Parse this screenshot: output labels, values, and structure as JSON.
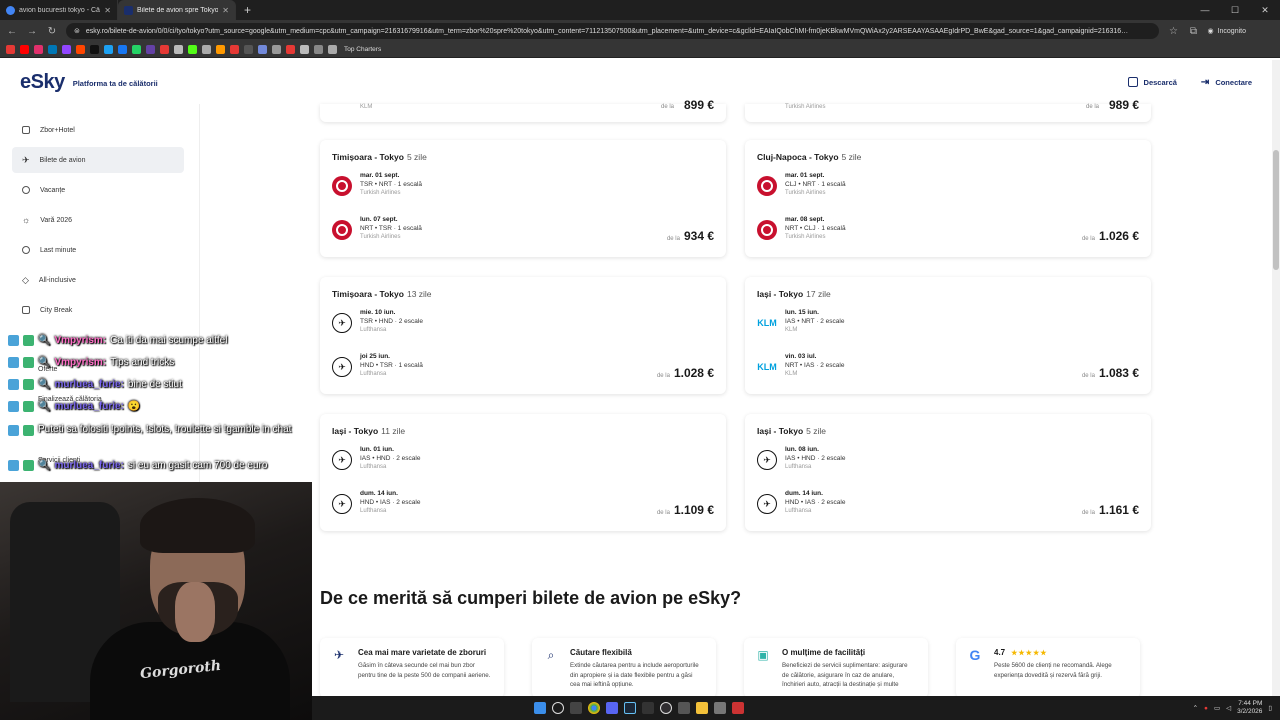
{
  "browser": {
    "tabs": [
      {
        "title": "avion bucuresti tokyo - Căutare",
        "favicon_color": "#4285f4",
        "active": false
      },
      {
        "title": "Bilete de avion spre Tokyo - Zb",
        "favicon_color": "#1a2e6c",
        "active": true
      }
    ],
    "url": "esky.ro/bilete-de-avion/0/0/ci/tyo/tokyo?utm_source=google&utm_medium=cpc&utm_campaign=21631679916&utm_term=zbor%20spre%20tokyo&utm_content=711213507500&utm_placement=&utm_device=c&gclid=EAIaIQobChMI-fm0jeKBkwMVmQWiAx2y2ARSEAAYASAAEgIdrPD_BwE&gad_source=1&gad_campaignid=216316…",
    "incognito_label": "Incognito",
    "bookmark_label": "Top Charters"
  },
  "header": {
    "logo": "eSky",
    "tagline": "Platforma ta de călătorii",
    "download_label": "Descarcă",
    "login_label": "Conectare"
  },
  "sidebar": {
    "items": [
      {
        "label": "Zbor+Hotel",
        "icon": "building-icon",
        "active": false
      },
      {
        "label": "Bilete de avion",
        "icon": "plane-icon",
        "active": true
      },
      {
        "label": "Vacanțe",
        "icon": "beach-icon",
        "active": false
      },
      {
        "label": "Vară 2026",
        "icon": "sun-icon",
        "active": false
      },
      {
        "label": "Last minute",
        "icon": "clock-icon",
        "active": false
      },
      {
        "label": "All-inclusive",
        "icon": "diamond-icon",
        "active": false
      },
      {
        "label": "City Break",
        "icon": "city-icon",
        "active": false
      }
    ]
  },
  "top_partial": [
    {
      "airline": "KLM",
      "from": "de la",
      "price": "899 €"
    },
    {
      "airline": "Turkish Airlines",
      "from": "de la",
      "price": "989 €"
    }
  ],
  "flights": [
    {
      "route": "Timișoara - Tokyo",
      "days": "5 zile",
      "from": "de la",
      "price": "934 €",
      "logo": "ta",
      "out": {
        "date": "mar. 01 sept.",
        "route": "TSR  •  NRT  · 1 escală",
        "airline": "Turkish Airlines"
      },
      "back": {
        "date": "lun. 07 sept.",
        "route": "NRT  •  TSR  · 1 escală",
        "airline": "Turkish Airlines"
      }
    },
    {
      "route": "Cluj-Napoca - Tokyo",
      "days": "5 zile",
      "from": "de la",
      "price": "1.026 €",
      "logo": "ta",
      "out": {
        "date": "mar. 01 sept.",
        "route": "CLJ  •  NRT  · 1 escală",
        "airline": "Turkish Airlines"
      },
      "back": {
        "date": "mar. 08 sept.",
        "route": "NRT  •  CLJ  · 1 escală",
        "airline": "Turkish Airlines"
      }
    },
    {
      "route": "Timișoara - Tokyo",
      "days": "13 zile",
      "from": "de la",
      "price": "1.028 €",
      "logo": "lh",
      "out": {
        "date": "mie. 10 iun.",
        "route": "TSR  •  HND  · 2 escale",
        "airline": "Lufthansa"
      },
      "back": {
        "date": "joi 25 iun.",
        "route": "HND  •  TSR  · 1 escală",
        "airline": "Lufthansa"
      }
    },
    {
      "route": "Iași - Tokyo",
      "days": "17 zile",
      "from": "de la",
      "price": "1.083 €",
      "logo": "klm",
      "out": {
        "date": "lun. 15 iun.",
        "route": "IAS  •  NRT  · 2 escale",
        "airline": "KLM"
      },
      "back": {
        "date": "vin. 03 iul.",
        "route": "NRT  •  IAS  · 2 escale",
        "airline": "KLM"
      }
    },
    {
      "route": "Iași - Tokyo",
      "days": "11 zile",
      "from": "de la",
      "price": "1.109 €",
      "logo": "lh",
      "out": {
        "date": "lun. 01 iun.",
        "route": "IAS  •  HND  · 2 escale",
        "airline": "Lufthansa"
      },
      "back": {
        "date": "dum. 14 iun.",
        "route": "HND  •  IAS  · 2 escale",
        "airline": "Lufthansa"
      }
    },
    {
      "route": "Iași - Tokyo",
      "days": "5 zile",
      "from": "de la",
      "price": "1.161 €",
      "logo": "lh",
      "out": {
        "date": "lun. 08 iun.",
        "route": "IAS  •  HND  · 2 escale",
        "airline": "Lufthansa"
      },
      "back": {
        "date": "dum. 14 iun.",
        "route": "HND  •  IAS  · 2 escale",
        "airline": "Lufthansa"
      }
    }
  ],
  "why_section": {
    "title": "De ce merită să cumperi bilete de avion pe eSky?",
    "features": [
      {
        "title": "Cea mai mare varietate de zboruri",
        "icon": "plane-icon",
        "desc": "Găsim în câteva secunde cel mai bun zbor pentru tine de la peste 500 de companii aeriene."
      },
      {
        "title": "Căutare flexibilă",
        "icon": "search-icon",
        "desc": "Extinde căutarea pentru a include aeroporturile din apropiere și ia date flexibile pentru a găsi cea mai ieftină opțiune."
      },
      {
        "title": "O mulțime de facilități",
        "icon": "grid-icon",
        "desc": "Beneficiezi de servicii suplimentare: asigurare de călătorie, asigurare în caz de anulare, închirieri auto, atracții la destinație și multe"
      },
      {
        "title": "4.7",
        "icon": "google-icon",
        "stars": "★★★★★",
        "desc": "Peste 5600 de clienți ne recomandă. Alege experiența dovedită și rezervă fără griji."
      }
    ]
  },
  "chat": {
    "lines": [
      {
        "user": "Vmpyrism:",
        "text": "Ca iti da mai scumpe altfel"
      },
      {
        "user": "Vmpyrism:",
        "text": "Tips and tricks"
      },
      {
        "user": "murluea_furie:",
        "text": "bine de stiut"
      },
      {
        "user": "murluea_furie:",
        "text": "😮"
      },
      {
        "user": "",
        "text": "Puteti sa folositi !points, !slots, !roulette si !gamble in chat"
      },
      {
        "user": "murluea_furie:",
        "text": "si eu am gasit cam 700 de euro"
      }
    ],
    "hidden_sidebar": [
      "Oferte",
      "Finalizează călătoria",
      "Servicii clienți"
    ]
  },
  "webcam": {
    "shirt_text": "Gorgoroth"
  },
  "taskbar": {
    "time": "7:44 PM",
    "date": "3/2/2026"
  }
}
